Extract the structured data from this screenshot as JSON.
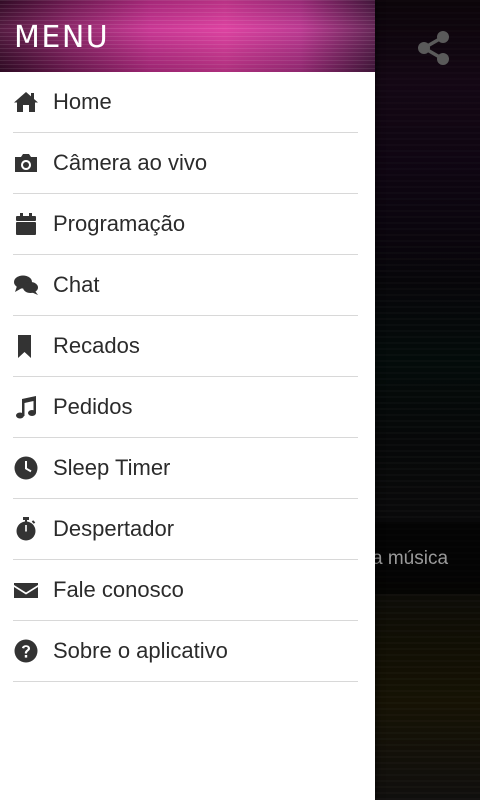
{
  "drawer": {
    "title": "MENU",
    "items": [
      {
        "label": "Home",
        "icon": "home-icon"
      },
      {
        "label": "Câmera ao vivo",
        "icon": "camera-icon"
      },
      {
        "label": "Programação",
        "icon": "calendar-icon"
      },
      {
        "label": "Chat",
        "icon": "chat-icon"
      },
      {
        "label": "Recados",
        "icon": "bookmark-icon"
      },
      {
        "label": "Pedidos",
        "icon": "music-note-icon"
      },
      {
        "label": "Sleep Timer",
        "icon": "clock-icon"
      },
      {
        "label": "Despertador",
        "icon": "stopwatch-icon"
      },
      {
        "label": "Fale conosco",
        "icon": "envelope-icon"
      },
      {
        "label": "Sobre o aplicativo",
        "icon": "question-circle-icon"
      }
    ]
  },
  "background": {
    "partial_text": "a música",
    "share_icon": "share-icon"
  },
  "colors": {
    "header_accent": "#d83a9b",
    "drawer_bg": "#ffffff",
    "text": "#2b2b2b"
  }
}
